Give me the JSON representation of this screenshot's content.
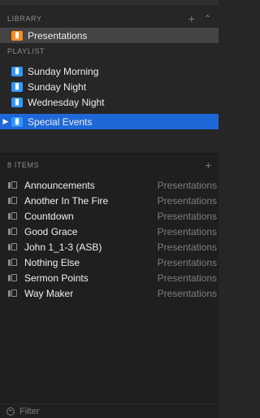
{
  "library": {
    "header": "LIBRARY",
    "add_icon": "plus-icon",
    "collapse_icon": "chevron-up-icon",
    "items": [
      {
        "label": "Presentations",
        "icon": "folder-icon",
        "color": "#ff8a1f",
        "selected": true
      }
    ]
  },
  "playlist": {
    "header": "PLAYLIST",
    "items": [
      {
        "label": "Sunday Morning",
        "icon": "folder-icon",
        "color": "#2f98ff",
        "selected": false
      },
      {
        "label": "Sunday Night",
        "icon": "folder-icon",
        "color": "#2f98ff",
        "selected": false
      },
      {
        "label": "Wednesday Night",
        "icon": "folder-icon",
        "color": "#2f98ff",
        "selected": false
      },
      {
        "label": "Special Events",
        "icon": "folder-icon",
        "color": "#2f98ff",
        "selected": true,
        "disclosure": "triangle-right-icon"
      }
    ]
  },
  "items_panel": {
    "count_label": "8 ITEMS",
    "add_icon": "plus-icon",
    "rows": [
      {
        "name": "Announcements",
        "library": "Presentations"
      },
      {
        "name": "Another In The Fire",
        "library": "Presentations"
      },
      {
        "name": "Countdown",
        "library": "Presentations"
      },
      {
        "name": "Good Grace",
        "library": "Presentations"
      },
      {
        "name": "John 1_1-3 (ASB)",
        "library": "Presentations"
      },
      {
        "name": "Nothing Else",
        "library": "Presentations"
      },
      {
        "name": "Sermon Points",
        "library": "Presentations"
      },
      {
        "name": "Way Maker",
        "library": "Presentations"
      }
    ]
  },
  "filter": {
    "placeholder": "Filter",
    "icon": "filter-icon"
  },
  "colors": {
    "selection_blue": "#1f68d8",
    "library_orange": "#ff8a1f",
    "playlist_blue": "#2f98ff"
  }
}
